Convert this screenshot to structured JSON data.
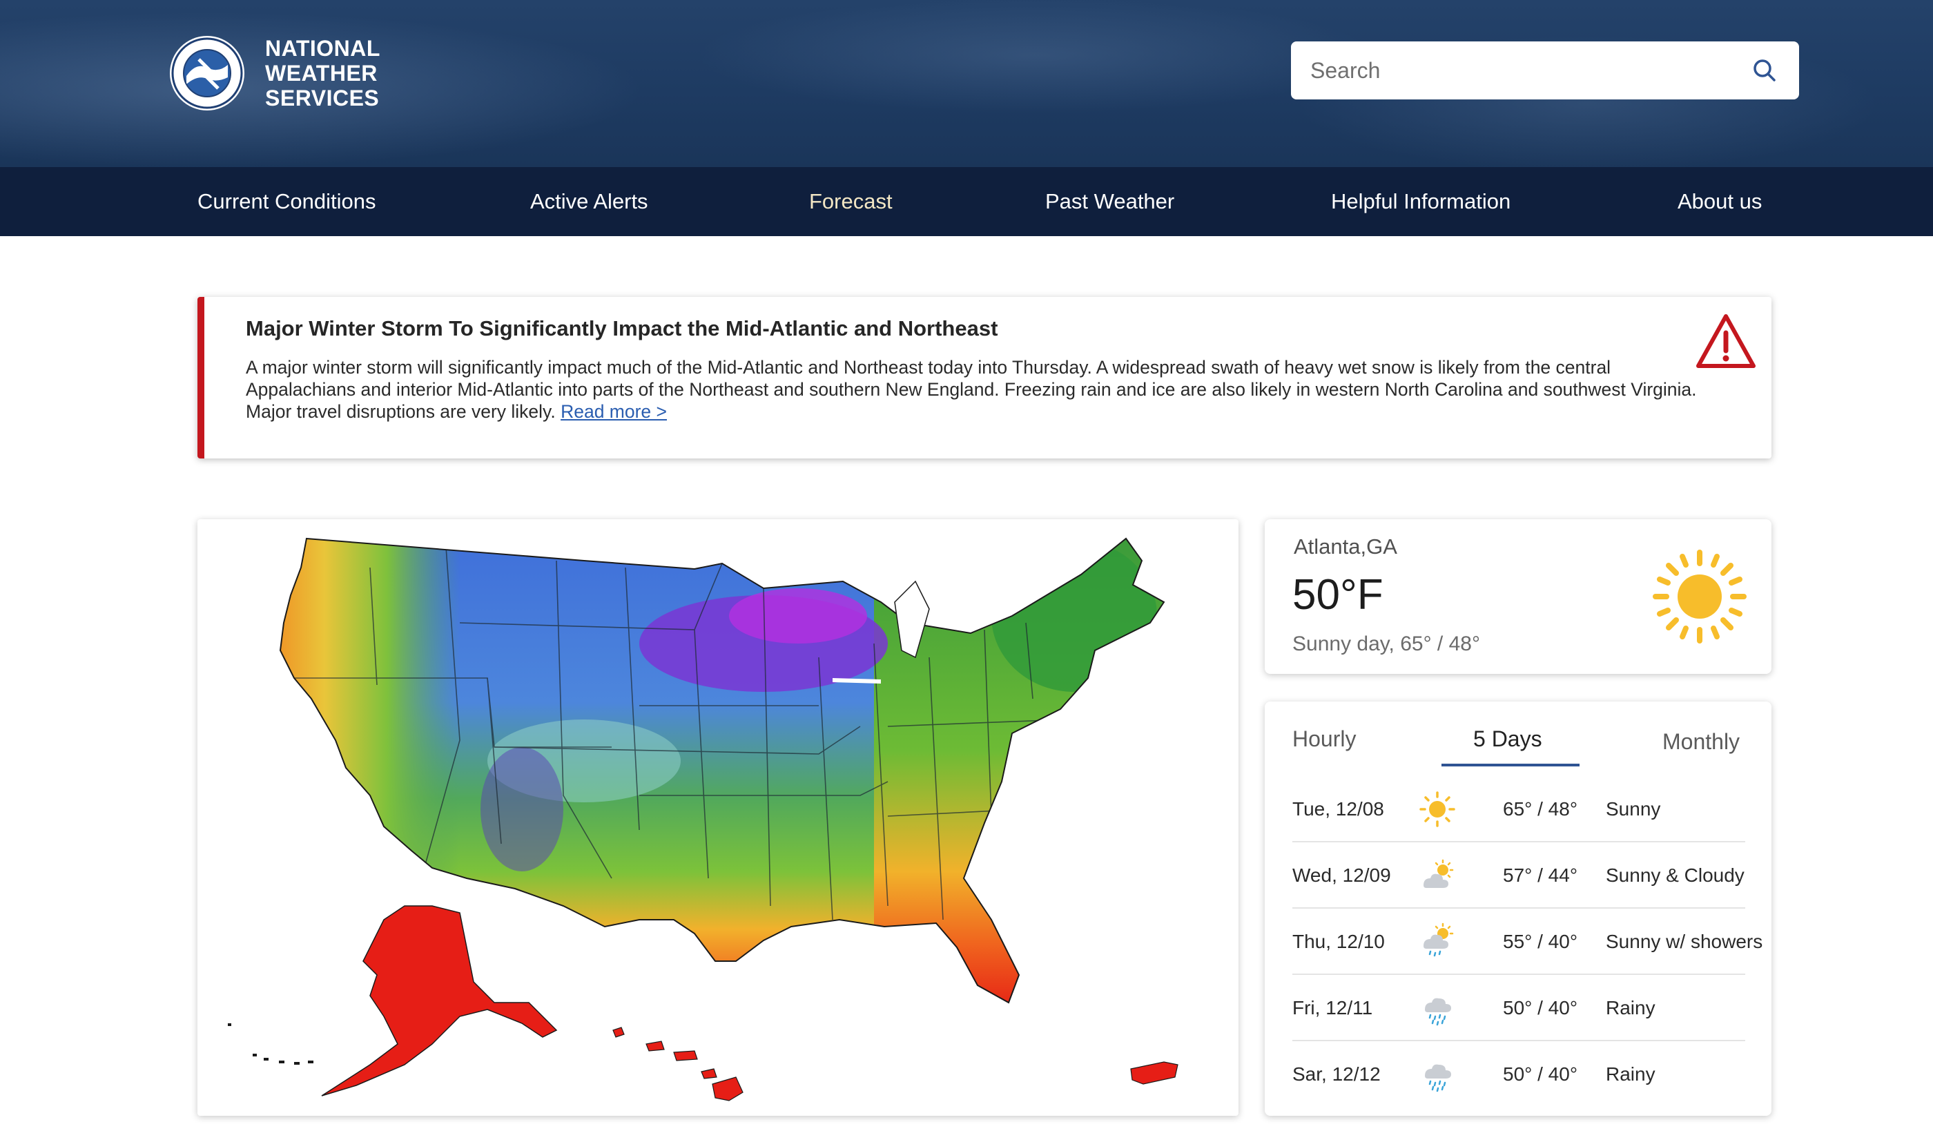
{
  "brand": {
    "line1": "NATIONAL",
    "line2": "WEATHER",
    "line3": "SERVICES",
    "logo_icon": "noaa-nws-logo-icon"
  },
  "search": {
    "placeholder": "Search",
    "icon": "search-icon"
  },
  "nav": {
    "items": [
      {
        "label": "Current Conditions"
      },
      {
        "label": "Active Alerts"
      },
      {
        "label": "Forecast",
        "active": true
      },
      {
        "label": "Past Weather"
      },
      {
        "label": "Helpful Information"
      },
      {
        "label": "About us"
      }
    ]
  },
  "alert": {
    "title": "Major Winter Storm To Significantly Impact the Mid-Atlantic and Northeast",
    "body": "A major winter storm will significantly impact much of the Mid-Atlantic and Northeast today into Thursday. A widespread swath of heavy wet snow is likely from the central Appalachians and interior Mid-Atlantic into parts of the Northeast and southern New England. Freezing rain and ice are also likely in western North Carolina and southwest Virginia. Major travel disruptions are very likely.",
    "link": "Read more >",
    "icon": "warning-triangle-icon",
    "accent_color": "#c4171e"
  },
  "map": {
    "icon": "us-temperature-map"
  },
  "current": {
    "city": "Atlanta,GA",
    "temp": "50°F",
    "desc": "Sunny day, 65° / 48°",
    "icon": "sun-icon"
  },
  "forecast": {
    "tabs": [
      {
        "label": "Hourly"
      },
      {
        "label": "5 Days",
        "active": true
      },
      {
        "label": "Monthly"
      }
    ],
    "rows": [
      {
        "day": "Tue, 12/08",
        "icon": "sun-icon",
        "temp": "65° / 48°",
        "cond": "Sunny"
      },
      {
        "day": "Wed, 12/09",
        "icon": "sun-cloud-icon",
        "temp": "57° / 44°",
        "cond": "Sunny & Cloudy"
      },
      {
        "day": "Thu, 12/10",
        "icon": "sun-shower-icon",
        "temp": "55° / 40°",
        "cond": "Sunny w/ showers"
      },
      {
        "day": "Fri, 12/11",
        "icon": "rain-icon",
        "temp": "50° / 40°",
        "cond": "Rainy"
      },
      {
        "day": "Sar, 12/12",
        "icon": "rain-icon",
        "temp": "50° / 40°",
        "cond": "Rainy"
      }
    ]
  }
}
